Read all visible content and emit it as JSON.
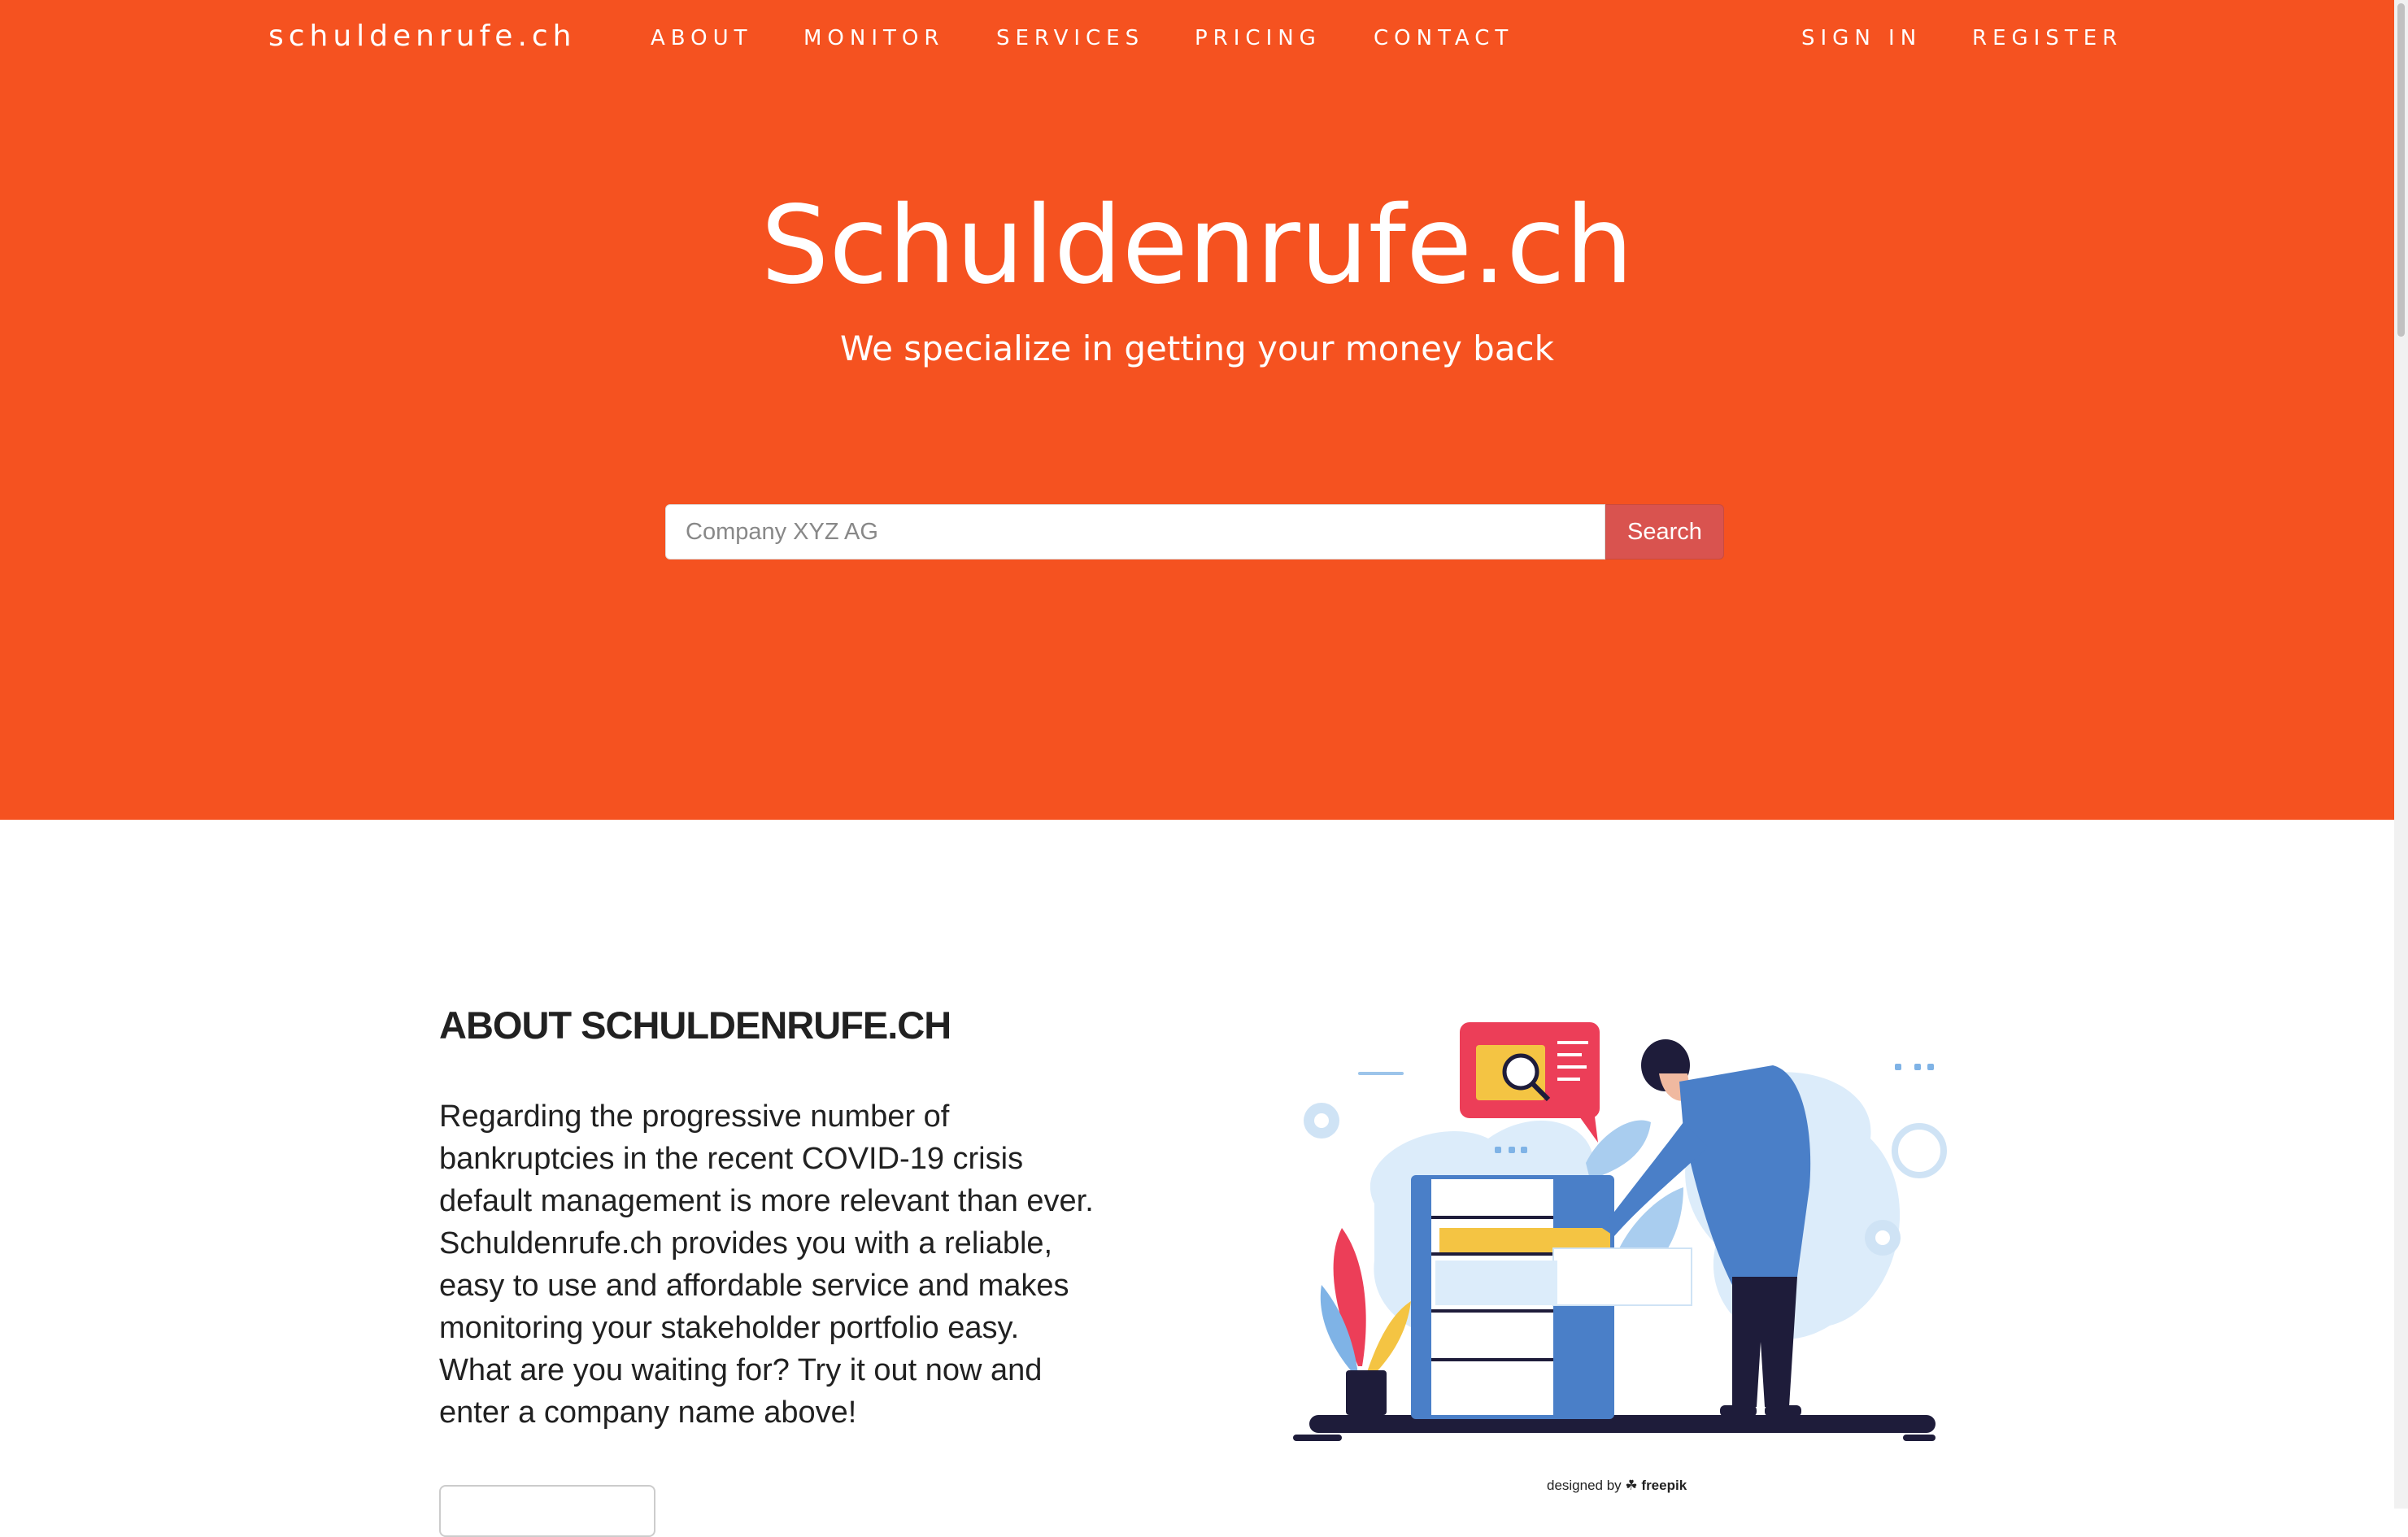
{
  "nav": {
    "brand": "schuldenrufe.ch",
    "links": [
      "ABOUT",
      "MONITOR",
      "SERVICES",
      "PRICING",
      "CONTACT"
    ],
    "sign_in": "SIGN IN",
    "register": "REGISTER"
  },
  "hero": {
    "title": "Schuldenrufe.ch",
    "subtitle": "We specialize in getting your money back",
    "search_placeholder": "Company XYZ AG",
    "search_button": "Search"
  },
  "about": {
    "title": "ABOUT SCHULDENRUFE.CH",
    "body": "Regarding the progressive number of bankruptcies in the recent COVID-19 crisis default management is more relevant than ever. Schuldenrufe.ch provides you with a reliable, easy to use and affordable service and makes monitoring your stakeholder portfolio easy. What are you waiting for? Try it out now and enter a company name above!"
  },
  "illustration": {
    "icon": "person-searching-files-illustration",
    "credit_prefix": "designed by",
    "credit_brand": "freepik"
  },
  "colors": {
    "hero_bg": "#f55220",
    "search_button_bg": "#d9534f",
    "text_dark": "#212121"
  }
}
